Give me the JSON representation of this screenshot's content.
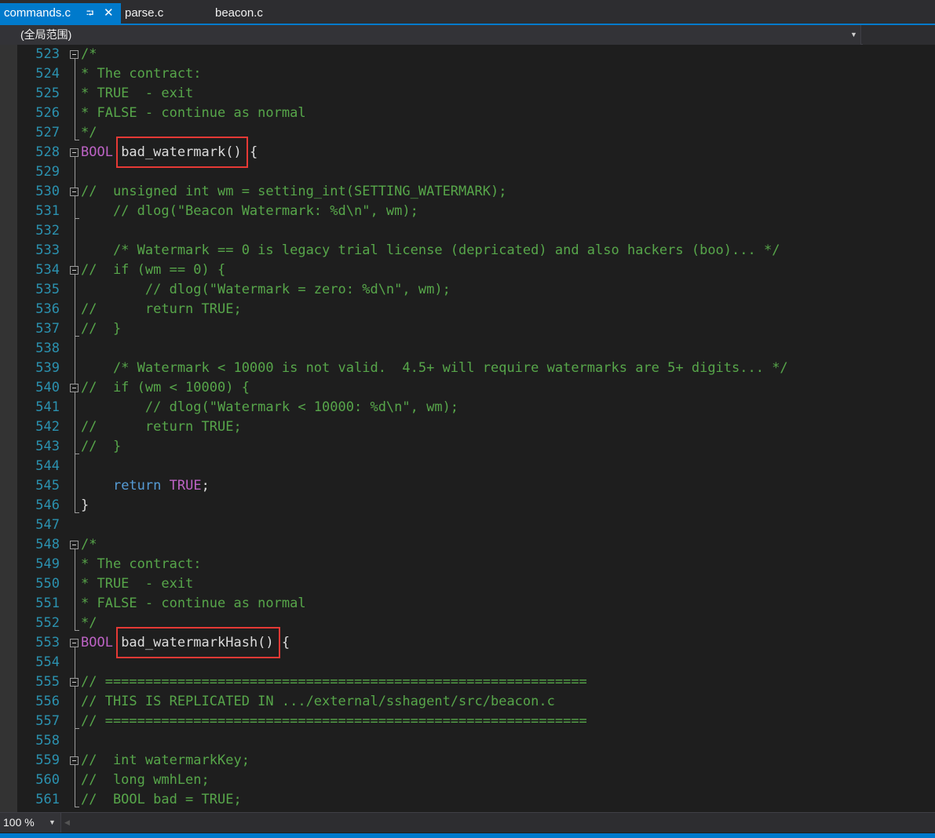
{
  "tabs": [
    {
      "label": "commands.c",
      "active": true,
      "pin_icon": "pin-icon",
      "close_icon": "close-icon"
    },
    {
      "label": "parse.c",
      "active": false
    },
    {
      "label": "beacon.c",
      "active": false
    }
  ],
  "scope": {
    "label": "(全局范围)",
    "icon": "chevron-down-icon"
  },
  "status": {
    "zoom": "100 %",
    "icon": "chevron-down-icon"
  },
  "colors": {
    "accent": "#007acc",
    "line_number": "#2b91af",
    "comment": "#57a64a",
    "keyword": "#569cd6",
    "macro": "#bd63c5",
    "text": "#dcdcdc",
    "highlight_box": "#e53935"
  },
  "code": {
    "lines": [
      {
        "num": "523",
        "tokens": [
          [
            "c",
            "/*"
          ]
        ]
      },
      {
        "num": "524",
        "tokens": [
          [
            "c",
            "* The contract:"
          ]
        ]
      },
      {
        "num": "525",
        "tokens": [
          [
            "c",
            "* TRUE  - exit"
          ]
        ]
      },
      {
        "num": "526",
        "tokens": [
          [
            "c",
            "* FALSE - continue as normal"
          ]
        ]
      },
      {
        "num": "527",
        "tokens": [
          [
            "c",
            "*/"
          ]
        ]
      },
      {
        "num": "528",
        "tokens": [
          [
            "m",
            "BOOL"
          ],
          [
            "t",
            " bad_watermark() {"
          ]
        ]
      },
      {
        "num": "529",
        "tokens": []
      },
      {
        "num": "530",
        "tokens": [
          [
            "c",
            "//  unsigned int wm = setting_int(SETTING_WATERMARK);"
          ]
        ]
      },
      {
        "num": "531",
        "tokens": [
          [
            "c",
            "    // dlog(\"Beacon Watermark: %d\\n\", wm);"
          ]
        ]
      },
      {
        "num": "532",
        "tokens": []
      },
      {
        "num": "533",
        "tokens": [
          [
            "c",
            "    /* Watermark == 0 is legacy trial license (depricated) and also hackers (boo)... */"
          ]
        ]
      },
      {
        "num": "534",
        "tokens": [
          [
            "c",
            "//  if (wm == 0) {"
          ]
        ]
      },
      {
        "num": "535",
        "tokens": [
          [
            "c",
            "        // dlog(\"Watermark = zero: %d\\n\", wm);"
          ]
        ]
      },
      {
        "num": "536",
        "tokens": [
          [
            "c",
            "//      return TRUE;"
          ]
        ]
      },
      {
        "num": "537",
        "tokens": [
          [
            "c",
            "//  }"
          ]
        ]
      },
      {
        "num": "538",
        "tokens": []
      },
      {
        "num": "539",
        "tokens": [
          [
            "c",
            "    /* Watermark < 10000 is not valid.  4.5+ will require watermarks are 5+ digits... */"
          ]
        ]
      },
      {
        "num": "540",
        "tokens": [
          [
            "c",
            "//  if (wm < 10000) {"
          ]
        ]
      },
      {
        "num": "541",
        "tokens": [
          [
            "c",
            "        // dlog(\"Watermark < 10000: %d\\n\", wm);"
          ]
        ]
      },
      {
        "num": "542",
        "tokens": [
          [
            "c",
            "//      return TRUE;"
          ]
        ]
      },
      {
        "num": "543",
        "tokens": [
          [
            "c",
            "//  }"
          ]
        ]
      },
      {
        "num": "544",
        "tokens": []
      },
      {
        "num": "545",
        "tokens": [
          [
            "t",
            "    "
          ],
          [
            "k",
            "return"
          ],
          [
            "t",
            " "
          ],
          [
            "m",
            "TRUE"
          ],
          [
            "t",
            ";"
          ]
        ]
      },
      {
        "num": "546",
        "tokens": [
          [
            "t",
            "}"
          ]
        ]
      },
      {
        "num": "547",
        "tokens": []
      },
      {
        "num": "548",
        "tokens": [
          [
            "c",
            "/*"
          ]
        ]
      },
      {
        "num": "549",
        "tokens": [
          [
            "c",
            "* The contract:"
          ]
        ]
      },
      {
        "num": "550",
        "tokens": [
          [
            "c",
            "* TRUE  - exit"
          ]
        ]
      },
      {
        "num": "551",
        "tokens": [
          [
            "c",
            "* FALSE - continue as normal"
          ]
        ]
      },
      {
        "num": "552",
        "tokens": [
          [
            "c",
            "*/"
          ]
        ]
      },
      {
        "num": "553",
        "tokens": [
          [
            "m",
            "BOOL"
          ],
          [
            "t",
            " bad_watermarkHash() {"
          ]
        ]
      },
      {
        "num": "554",
        "tokens": []
      },
      {
        "num": "555",
        "tokens": [
          [
            "c",
            "// ============================================================"
          ]
        ]
      },
      {
        "num": "556",
        "tokens": [
          [
            "c",
            "// THIS IS REPLICATED IN .../external/sshagent/src/beacon.c"
          ]
        ]
      },
      {
        "num": "557",
        "tokens": [
          [
            "c",
            "// ============================================================"
          ]
        ]
      },
      {
        "num": "558",
        "tokens": []
      },
      {
        "num": "559",
        "tokens": [
          [
            "c",
            "//  int watermarkKey;"
          ]
        ]
      },
      {
        "num": "560",
        "tokens": [
          [
            "c",
            "//  long wmhLen;"
          ]
        ]
      },
      {
        "num": "561",
        "tokens": [
          [
            "c",
            "//  BOOL bad = TRUE;"
          ]
        ]
      }
    ],
    "fold_markers": [
      "523",
      "528",
      "530",
      "534",
      "540",
      "548",
      "553",
      "555",
      "559"
    ],
    "highlights": [
      {
        "line": "528",
        "text": "bad_watermark()"
      },
      {
        "line": "553",
        "text": "bad_watermarkHash()"
      }
    ]
  }
}
